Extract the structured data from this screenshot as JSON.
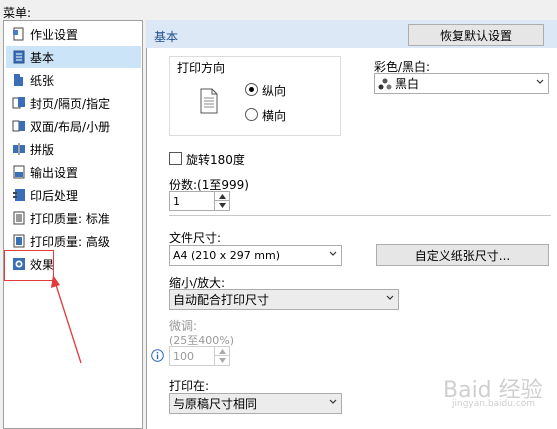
{
  "menu": {
    "label": "菜单:",
    "items": [
      {
        "label": "作业设置",
        "icon": "job-settings-icon"
      },
      {
        "label": "基本",
        "icon": "basic-icon"
      },
      {
        "label": "纸张",
        "icon": "paper-icon"
      },
      {
        "label": "封页/隔页/指定",
        "icon": "cover-page-icon"
      },
      {
        "label": "双面/布局/小册",
        "icon": "duplex-layout-icon"
      },
      {
        "label": "拼版",
        "icon": "imposition-icon"
      },
      {
        "label": "输出设置",
        "icon": "output-settings-icon"
      },
      {
        "label": "印后处理",
        "icon": "finishing-icon"
      },
      {
        "label": "打印质量: 标准",
        "icon": "quality-standard-icon"
      },
      {
        "label": "打印质量: 高级",
        "icon": "quality-advanced-icon"
      },
      {
        "label": "效果",
        "icon": "effect-icon"
      }
    ],
    "selected_index": 1,
    "highlighted_item": "效果",
    "highlight_color": "#e23b3b"
  },
  "header": {
    "title": "基本",
    "restore_defaults_label": "恢复默认设置"
  },
  "orientation": {
    "title": "打印方向",
    "portrait_label": "纵向",
    "landscape_label": "横向",
    "selected": "纵向"
  },
  "color": {
    "label": "彩色/黑白:",
    "value": "黑白"
  },
  "rotate": {
    "label": "旋转180度",
    "checked": false
  },
  "copies": {
    "label": "份数:(1至999)",
    "value": "1"
  },
  "paper_size": {
    "label": "文件尺寸:",
    "value": "A4 (210 x 297 mm)",
    "custom_button_label": "自定义纸张尺寸..."
  },
  "scale": {
    "label": "缩小/放大:",
    "value": "自动配合打印尺寸"
  },
  "fine_tune": {
    "label": "微调:",
    "range_label": "(25至400%)",
    "value": "100",
    "enabled": false
  },
  "print_on": {
    "label": "打印在:",
    "value": "与原稿尺寸相同"
  },
  "watermark": {
    "text": "Baid",
    "text2": "经验",
    "sub": "jingyan.baidu.com"
  },
  "colors": {
    "header_bg": "#dce8f5",
    "selected_bg": "#cce4f7",
    "accent": "#1e4d8c",
    "arrow": "#e23b3b"
  }
}
